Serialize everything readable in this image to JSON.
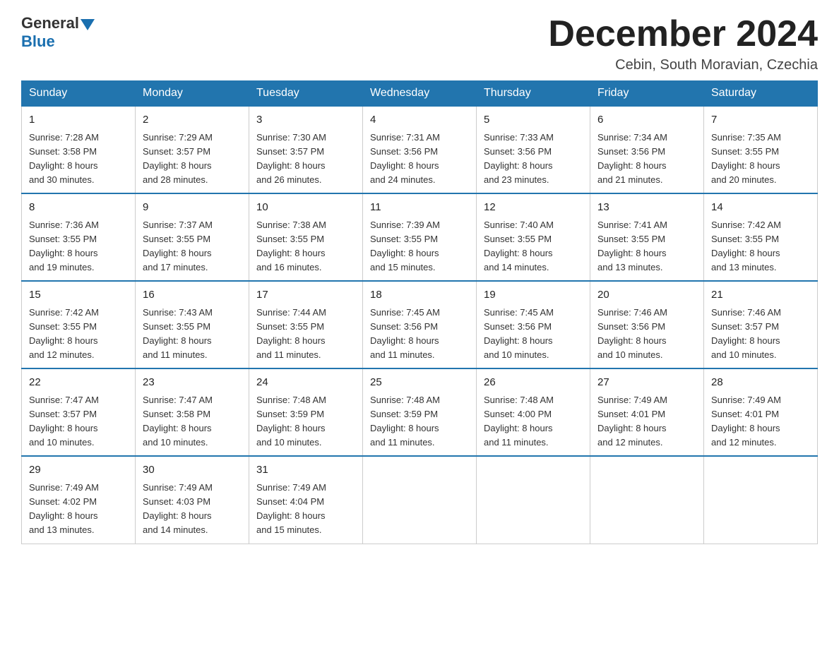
{
  "header": {
    "logo_general": "General",
    "logo_blue": "Blue",
    "month_title": "December 2024",
    "subtitle": "Cebin, South Moravian, Czechia"
  },
  "days_of_week": [
    "Sunday",
    "Monday",
    "Tuesday",
    "Wednesday",
    "Thursday",
    "Friday",
    "Saturday"
  ],
  "weeks": [
    [
      {
        "day": "1",
        "sunrise": "7:28 AM",
        "sunset": "3:58 PM",
        "daylight": "8 hours and 30 minutes."
      },
      {
        "day": "2",
        "sunrise": "7:29 AM",
        "sunset": "3:57 PM",
        "daylight": "8 hours and 28 minutes."
      },
      {
        "day": "3",
        "sunrise": "7:30 AM",
        "sunset": "3:57 PM",
        "daylight": "8 hours and 26 minutes."
      },
      {
        "day": "4",
        "sunrise": "7:31 AM",
        "sunset": "3:56 PM",
        "daylight": "8 hours and 24 minutes."
      },
      {
        "day": "5",
        "sunrise": "7:33 AM",
        "sunset": "3:56 PM",
        "daylight": "8 hours and 23 minutes."
      },
      {
        "day": "6",
        "sunrise": "7:34 AM",
        "sunset": "3:56 PM",
        "daylight": "8 hours and 21 minutes."
      },
      {
        "day": "7",
        "sunrise": "7:35 AM",
        "sunset": "3:55 PM",
        "daylight": "8 hours and 20 minutes."
      }
    ],
    [
      {
        "day": "8",
        "sunrise": "7:36 AM",
        "sunset": "3:55 PM",
        "daylight": "8 hours and 19 minutes."
      },
      {
        "day": "9",
        "sunrise": "7:37 AM",
        "sunset": "3:55 PM",
        "daylight": "8 hours and 17 minutes."
      },
      {
        "day": "10",
        "sunrise": "7:38 AM",
        "sunset": "3:55 PM",
        "daylight": "8 hours and 16 minutes."
      },
      {
        "day": "11",
        "sunrise": "7:39 AM",
        "sunset": "3:55 PM",
        "daylight": "8 hours and 15 minutes."
      },
      {
        "day": "12",
        "sunrise": "7:40 AM",
        "sunset": "3:55 PM",
        "daylight": "8 hours and 14 minutes."
      },
      {
        "day": "13",
        "sunrise": "7:41 AM",
        "sunset": "3:55 PM",
        "daylight": "8 hours and 13 minutes."
      },
      {
        "day": "14",
        "sunrise": "7:42 AM",
        "sunset": "3:55 PM",
        "daylight": "8 hours and 13 minutes."
      }
    ],
    [
      {
        "day": "15",
        "sunrise": "7:42 AM",
        "sunset": "3:55 PM",
        "daylight": "8 hours and 12 minutes."
      },
      {
        "day": "16",
        "sunrise": "7:43 AM",
        "sunset": "3:55 PM",
        "daylight": "8 hours and 11 minutes."
      },
      {
        "day": "17",
        "sunrise": "7:44 AM",
        "sunset": "3:55 PM",
        "daylight": "8 hours and 11 minutes."
      },
      {
        "day": "18",
        "sunrise": "7:45 AM",
        "sunset": "3:56 PM",
        "daylight": "8 hours and 11 minutes."
      },
      {
        "day": "19",
        "sunrise": "7:45 AM",
        "sunset": "3:56 PM",
        "daylight": "8 hours and 10 minutes."
      },
      {
        "day": "20",
        "sunrise": "7:46 AM",
        "sunset": "3:56 PM",
        "daylight": "8 hours and 10 minutes."
      },
      {
        "day": "21",
        "sunrise": "7:46 AM",
        "sunset": "3:57 PM",
        "daylight": "8 hours and 10 minutes."
      }
    ],
    [
      {
        "day": "22",
        "sunrise": "7:47 AM",
        "sunset": "3:57 PM",
        "daylight": "8 hours and 10 minutes."
      },
      {
        "day": "23",
        "sunrise": "7:47 AM",
        "sunset": "3:58 PM",
        "daylight": "8 hours and 10 minutes."
      },
      {
        "day": "24",
        "sunrise": "7:48 AM",
        "sunset": "3:59 PM",
        "daylight": "8 hours and 10 minutes."
      },
      {
        "day": "25",
        "sunrise": "7:48 AM",
        "sunset": "3:59 PM",
        "daylight": "8 hours and 11 minutes."
      },
      {
        "day": "26",
        "sunrise": "7:48 AM",
        "sunset": "4:00 PM",
        "daylight": "8 hours and 11 minutes."
      },
      {
        "day": "27",
        "sunrise": "7:49 AM",
        "sunset": "4:01 PM",
        "daylight": "8 hours and 12 minutes."
      },
      {
        "day": "28",
        "sunrise": "7:49 AM",
        "sunset": "4:01 PM",
        "daylight": "8 hours and 12 minutes."
      }
    ],
    [
      {
        "day": "29",
        "sunrise": "7:49 AM",
        "sunset": "4:02 PM",
        "daylight": "8 hours and 13 minutes."
      },
      {
        "day": "30",
        "sunrise": "7:49 AM",
        "sunset": "4:03 PM",
        "daylight": "8 hours and 14 minutes."
      },
      {
        "day": "31",
        "sunrise": "7:49 AM",
        "sunset": "4:04 PM",
        "daylight": "8 hours and 15 minutes."
      },
      null,
      null,
      null,
      null
    ]
  ],
  "labels": {
    "sunrise": "Sunrise: ",
    "sunset": "Sunset: ",
    "daylight": "Daylight: "
  }
}
